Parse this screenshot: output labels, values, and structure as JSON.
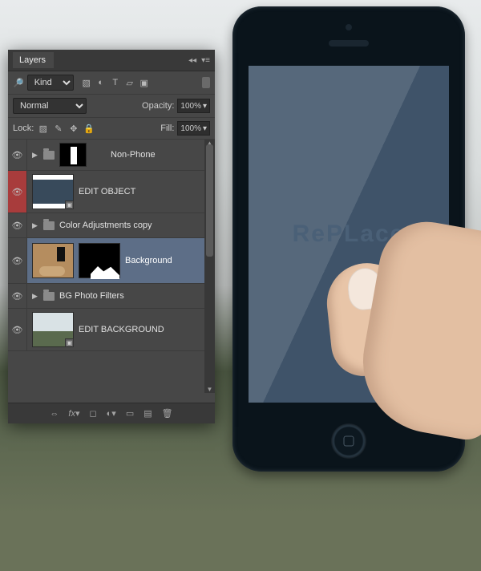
{
  "mockup": {
    "screen_text": "RePLace"
  },
  "panel": {
    "title": "Layers",
    "kind_search_label": "Kind",
    "blend_mode": "Normal",
    "opacity_label": "Opacity:",
    "opacity_value": "100%",
    "lock_label": "Lock:",
    "fill_label": "Fill:",
    "fill_value": "100%",
    "filter_icons": [
      "image-icon",
      "adjustments-icon",
      "type-icon",
      "shape-icon",
      "smartobject-icon"
    ],
    "layers": [
      {
        "name": "Non-Phone",
        "type": "group-masked",
        "visible": true
      },
      {
        "name": "EDIT OBJECT",
        "type": "smart-object",
        "visible": true,
        "selected": "red"
      },
      {
        "name": "Color Adjustments copy",
        "type": "group",
        "visible": true
      },
      {
        "name": "Background",
        "type": "group-masked-large",
        "visible": true,
        "selected": "blue"
      },
      {
        "name": "BG Photo Filters",
        "type": "group",
        "visible": true
      },
      {
        "name": "EDIT BACKGROUND",
        "type": "smart-object",
        "visible": true
      }
    ],
    "bottom_icons": [
      "link-icon",
      "fx-icon",
      "mask-icon",
      "adjust-icon",
      "group-icon",
      "new-icon",
      "trash-icon"
    ]
  }
}
